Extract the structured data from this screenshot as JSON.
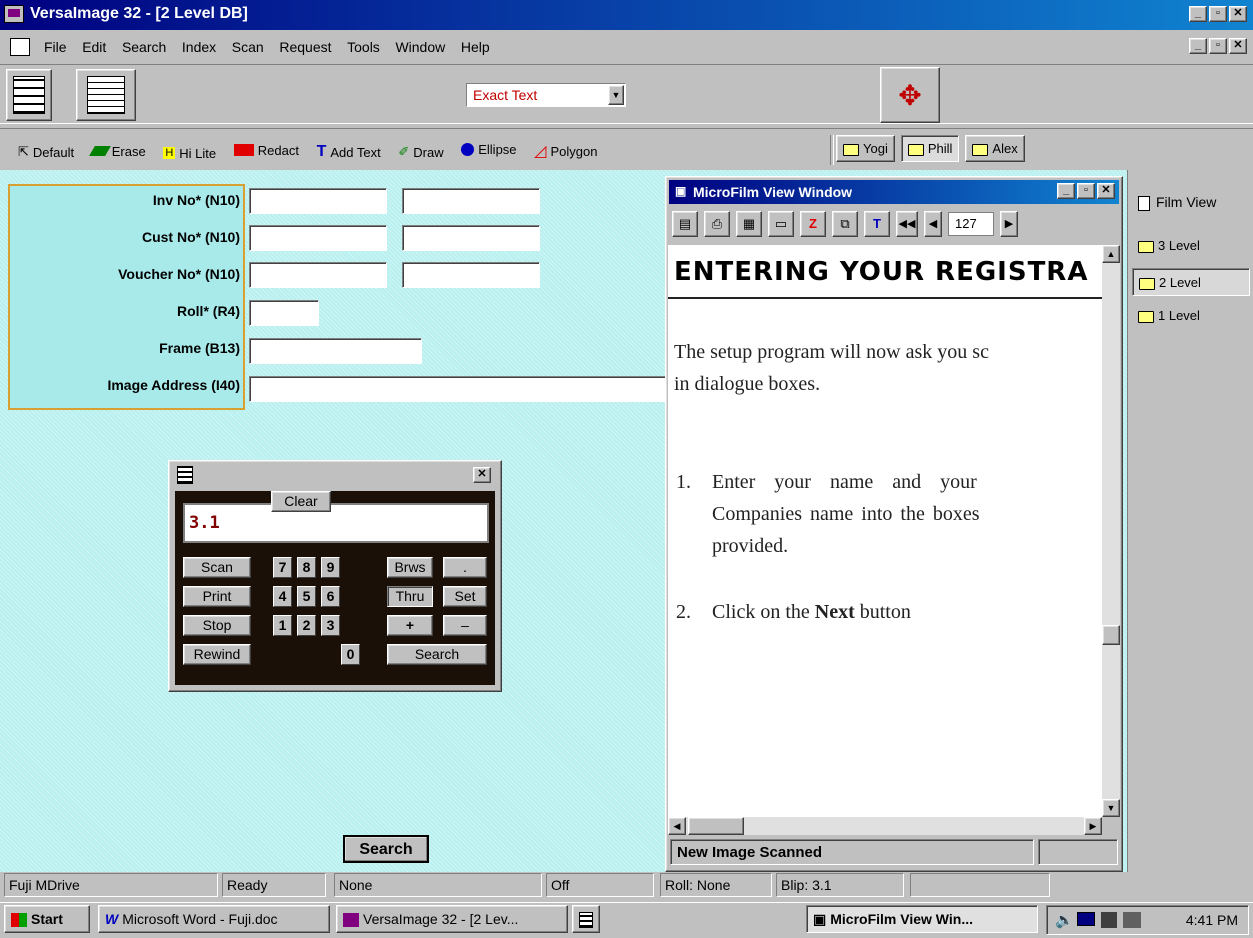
{
  "app": {
    "title": "VersaImage 32 - [2 Level DB]"
  },
  "menu": [
    "File",
    "Edit",
    "Search",
    "Index",
    "Scan",
    "Request",
    "Tools",
    "Window",
    "Help"
  ],
  "toolbar": {
    "search_mode": "Exact Text"
  },
  "annotation_tools": [
    "Default",
    "Erase",
    "Hi Lite",
    "Redact",
    "Add Text",
    "Draw",
    "Ellipse",
    "Polygon"
  ],
  "users": [
    "Yogi",
    "Phill",
    "Alex"
  ],
  "fields": [
    {
      "label": "Inv No* (N10)"
    },
    {
      "label": "Cust No* (N10)"
    },
    {
      "label": "Voucher No* (N10)"
    },
    {
      "label": "Roll* (R4)"
    },
    {
      "label": "Frame (B13)"
    },
    {
      "label": "Image Address (I40)"
    }
  ],
  "search_button": "Search",
  "calculator": {
    "display": "3.1",
    "buttons": {
      "scan": "Scan",
      "print": "Print",
      "stop": "Stop",
      "rewind": "Rewind",
      "clear": "Clear",
      "brws": "Brws",
      "dot": ".",
      "thru": "Thru",
      "set": "Set",
      "plus": "+",
      "minus": "–",
      "search": "Search"
    },
    "digits": [
      "7",
      "8",
      "9",
      "4",
      "5",
      "6",
      "1",
      "2",
      "3",
      "0"
    ]
  },
  "microfilm": {
    "title": "MicroFilm View Window",
    "frame_number": "127",
    "heading": "ENTERING YOUR REGISTRA",
    "para1_line1": "The setup program will now ask you sc",
    "para1_line2": "in dialogue boxes.",
    "item1_num": "1.",
    "item1_line1": "Enter your name and your",
    "item1_line2": "Companies name into the boxes",
    "item1_line3": "provided.",
    "item2_num": "2.",
    "item2_pre": "Click on the ",
    "item2_bold": "Next",
    "item2_post": " button",
    "status": "New Image Scanned"
  },
  "side_panel": {
    "film_view": "Film View",
    "levels": [
      "3 Level",
      "2 Level",
      "1 Level"
    ]
  },
  "status_bar": [
    "Fuji MDrive",
    "Ready",
    "None",
    "Off",
    "Roll: None",
    "Blip: 3.1"
  ],
  "taskbar": {
    "start": "Start",
    "tasks": [
      "Microsoft Word - Fuji.doc",
      "VersaImage 32 - [2 Lev...",
      "",
      "MicroFilm View Win..."
    ],
    "clock": "4:41 PM"
  }
}
